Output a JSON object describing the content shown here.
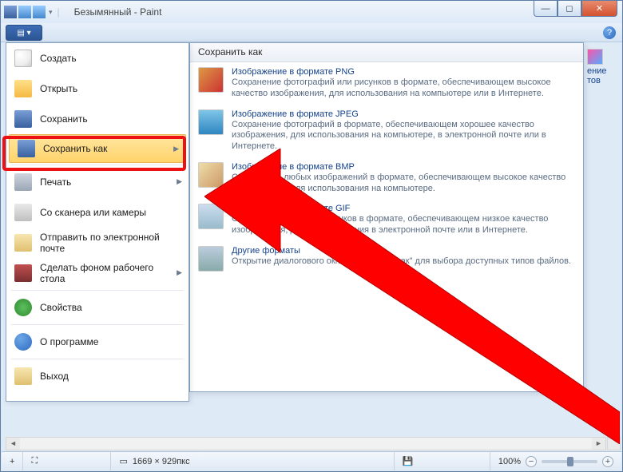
{
  "title": "Безымянный - Paint",
  "ribbon": {
    "help_tooltip": "?"
  },
  "peek": {
    "line1": "ение",
    "line2": "тов"
  },
  "filemenu": {
    "items": [
      {
        "label": "Создать",
        "icon": "ic-new",
        "arrow": false
      },
      {
        "label": "Открыть",
        "icon": "ic-open",
        "arrow": false
      },
      {
        "label": "Сохранить",
        "icon": "ic-save",
        "arrow": false
      },
      {
        "label": "Сохранить как",
        "icon": "ic-saveas",
        "arrow": true,
        "selected": true
      },
      {
        "label": "Печать",
        "icon": "ic-print",
        "arrow": true
      },
      {
        "label": "Со сканера или камеры",
        "icon": "ic-scan",
        "arrow": false
      },
      {
        "label": "Отправить по электронной почте",
        "icon": "ic-mail",
        "arrow": false
      },
      {
        "label": "Сделать фоном рабочего стола",
        "icon": "ic-desk",
        "arrow": true
      },
      {
        "label": "Свойства",
        "icon": "ic-prop",
        "arrow": false
      },
      {
        "label": "О программе",
        "icon": "ic-about",
        "arrow": false
      },
      {
        "label": "Выход",
        "icon": "ic-exit",
        "arrow": false
      }
    ]
  },
  "submenu": {
    "header": "Сохранить как",
    "items": [
      {
        "title": "Изображение в формате PNG",
        "desc": "Сохранение фотографий или рисунков в формате, обеспечивающем высокое качество изображения, для использования на компьютере или в Интернете.",
        "thumb": "th-png"
      },
      {
        "title": "Изображение в формате JPEG",
        "desc": "Сохранение фотографий в формате, обеспечивающем хорошее качество изображения, для использования на компьютере, в электронной почте или в Интернете.",
        "thumb": "th-jpeg"
      },
      {
        "title": "Изображение в формате BMP",
        "desc": "Сохранение любых изображений в формате, обеспечивающем высокое качество изображения, для использования на компьютере.",
        "thumb": "th-bmp"
      },
      {
        "title": "Изображение в формате GIF",
        "desc": "Сохранение простых рисунков в формате, обеспечивающем низкое качество изображения, для использования в электронной почте или в Интернете.",
        "thumb": "th-gif"
      },
      {
        "title": "Другие форматы",
        "desc": "Открытие диалогового окна \"Сохранить как\" для выбора доступных типов файлов.",
        "thumb": "th-other"
      }
    ]
  },
  "status": {
    "cursor": "+",
    "dimensions": "1669 × 929пкс",
    "zoom": "100%"
  }
}
